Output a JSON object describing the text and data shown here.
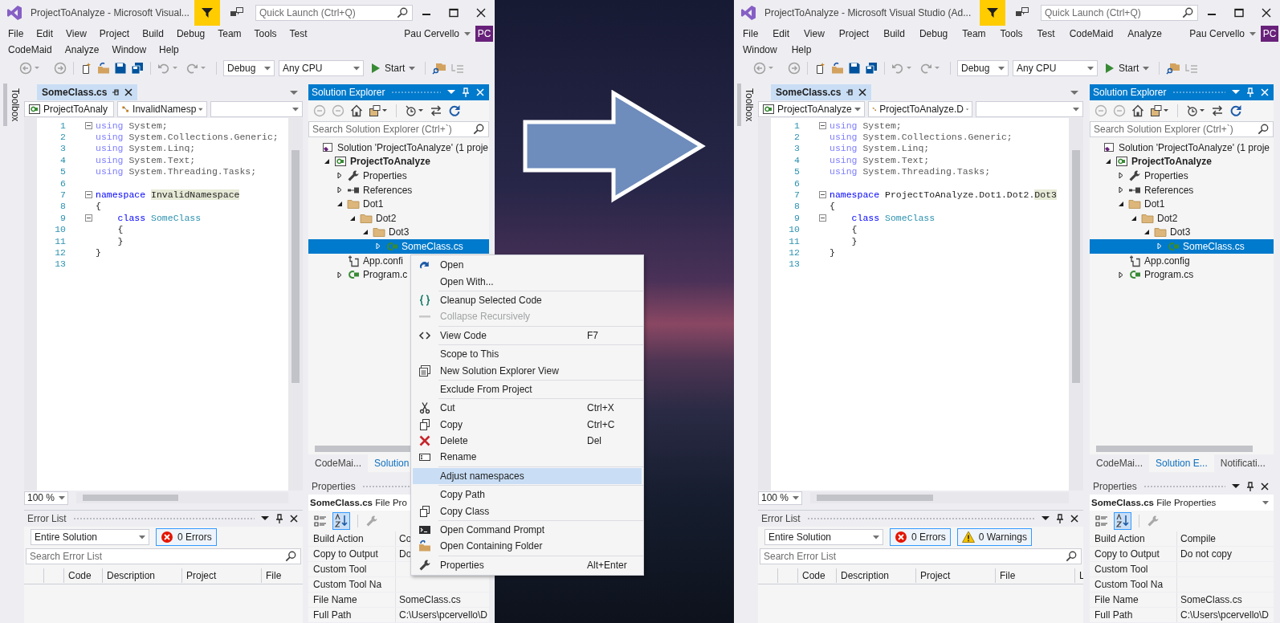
{
  "windows": [
    {
      "title": "ProjectToAnalyze - Microsoft Visual...",
      "quick_launch": {
        "placeholder": "Quick Launch (Ctrl+Q)"
      },
      "user": "Pau Cervello",
      "user_initials": "PC",
      "menu_rows": [
        [
          "File",
          "Edit",
          "View",
          "Project",
          "Build",
          "Debug",
          "Team",
          "Tools",
          "Test"
        ],
        [
          "CodeMaid",
          "Analyze",
          "Window",
          "Help"
        ]
      ],
      "toolbar": {
        "configuration": "Debug",
        "platform": "Any CPU",
        "start": "Start"
      },
      "toolbox": "Toolbox",
      "editor": {
        "tab": "SomeClass.cs",
        "project_nav": "ProjectToAnaly",
        "member_nav": "InvalidNamesp",
        "zoom": "100 %",
        "lines": [
          {
            "number": "1",
            "collapsible": true,
            "tokens": [
              {
                "kind": "unused_keyword",
                "text": "using"
              },
              {
                "kind": "unused",
                "text": " System;"
              }
            ]
          },
          {
            "number": "2",
            "collapsible": false,
            "tokens": [
              {
                "kind": "unused_keyword",
                "text": "using"
              },
              {
                "kind": "unused",
                "text": " System.Collections.Generic;"
              }
            ]
          },
          {
            "number": "3",
            "collapsible": false,
            "tokens": [
              {
                "kind": "unused_keyword",
                "text": "using"
              },
              {
                "kind": "unused",
                "text": " System.Linq;"
              }
            ]
          },
          {
            "number": "4",
            "collapsible": false,
            "tokens": [
              {
                "kind": "unused_keyword",
                "text": "using"
              },
              {
                "kind": "unused",
                "text": " System.Text;"
              }
            ]
          },
          {
            "number": "5",
            "collapsible": false,
            "tokens": [
              {
                "kind": "unused_keyword",
                "text": "using"
              },
              {
                "kind": "unused",
                "text": " System.Threading.Tasks;"
              }
            ]
          },
          {
            "number": "6",
            "collapsible": false
          },
          {
            "number": "7",
            "collapsible": true,
            "tokens": [
              {
                "kind": "keyword",
                "text": "namespace "
              },
              {
                "kind": "highlight",
                "text": "InvalidNamespace"
              }
            ]
          },
          {
            "number": "8",
            "collapsible": false,
            "tokens": [
              {
                "kind": "plain",
                "text": "{"
              }
            ]
          },
          {
            "number": "9",
            "collapsible": true,
            "tokens": [
              {
                "kind": "keyword",
                "text": "    class"
              },
              {
                "kind": "type",
                "text": " SomeClass"
              }
            ]
          },
          {
            "number": "10",
            "collapsible": false,
            "tokens": [
              {
                "kind": "plain",
                "text": "    {"
              }
            ]
          },
          {
            "number": "11",
            "collapsible": false,
            "tokens": [
              {
                "kind": "plain",
                "text": "    }"
              }
            ]
          },
          {
            "number": "12",
            "collapsible": false,
            "tokens": [
              {
                "kind": "plain",
                "text": "}"
              }
            ]
          },
          {
            "number": "13",
            "collapsible": false
          }
        ]
      },
      "error_list": {
        "title": "Error List",
        "scope": "Entire Solution",
        "filters": [
          {
            "kind": "errors",
            "label": "0 Errors",
            "selected": true
          }
        ],
        "search": {
          "placeholder": "Search Error List"
        },
        "columns": [
          "Code",
          "Description",
          "Project",
          "File"
        ]
      },
      "solution_explorer": {
        "title": "Solution Explorer",
        "search": {
          "placeholder": "Search Solution Explorer (Ctrl+`)"
        },
        "tree": [
          {
            "label": "Solution 'ProjectToAnalyze' (1 proje",
            "kind": "solution",
            "selected": false,
            "children": [
              {
                "label": "ProjectToAnalyze",
                "kind": "csproj",
                "expanded": true,
                "selected": false,
                "children": [
                  {
                    "label": "Properties",
                    "kind": "wrench",
                    "expanded": false,
                    "selected": false
                  },
                  {
                    "label": "References",
                    "kind": "references",
                    "expanded": false,
                    "selected": false
                  },
                  {
                    "label": "Dot1",
                    "kind": "folder",
                    "expanded": true,
                    "selected": false,
                    "children": [
                      {
                        "label": "Dot2",
                        "kind": "folder",
                        "expanded": true,
                        "selected": false,
                        "children": [
                          {
                            "label": "Dot3",
                            "kind": "folder",
                            "expanded": true,
                            "selected": false,
                            "children": [
                              {
                                "label": "SomeClass.cs",
                                "kind": "csfile",
                                "expanded": false,
                                "selected": true
                              }
                            ]
                          }
                        ]
                      }
                    ]
                  },
                  {
                    "label": "App.confi",
                    "kind": "config",
                    "selected": false
                  },
                  {
                    "label": "Program.c",
                    "kind": "csfile",
                    "expanded": false,
                    "selected": false
                  }
                ]
              }
            ]
          }
        ],
        "tabs": [
          {
            "label": "CodeMai...",
            "selected": false
          },
          {
            "label": "Solution",
            "selected": true
          }
        ]
      },
      "properties": {
        "title": "Properties",
        "object": "SomeClass.cs",
        "object_type": "File Pro",
        "rows": [
          {
            "name": "Build Action",
            "value": "Co"
          },
          {
            "name": "Copy to Output",
            "value": "Do"
          },
          {
            "name": "Custom Tool"
          },
          {
            "name": "Custom Tool Na"
          },
          {
            "name": "File Name",
            "value": "SomeClass.cs"
          },
          {
            "name": "Full Path",
            "value": "C:\\Users\\pcervello\\D"
          }
        ]
      }
    },
    {
      "title": "ProjectToAnalyze - Microsoft Visual Studio (Ad...",
      "quick_launch": {
        "placeholder": "Quick Launch (Ctrl+Q)"
      },
      "user": "Pau Cervello",
      "user_initials": "PC",
      "menu_rows": [
        [
          "File",
          "Edit",
          "View",
          "Project",
          "Build",
          "Debug",
          "Team",
          "Tools",
          "Test",
          "CodeMaid",
          "Analyze"
        ],
        [
          "Window",
          "Help"
        ]
      ],
      "toolbar": {
        "configuration": "Debug",
        "platform": "Any CPU",
        "start": "Start"
      },
      "toolbox": "Toolbox",
      "editor": {
        "tab": "SomeClass.cs",
        "project_nav": "ProjectToAnalyze",
        "member_nav": "ProjectToAnalyze.D",
        "zoom": "100 %",
        "lines": [
          {
            "number": "1",
            "collapsible": true,
            "tokens": [
              {
                "kind": "unused_keyword",
                "text": "using"
              },
              {
                "kind": "unused",
                "text": " System;"
              }
            ]
          },
          {
            "number": "2",
            "collapsible": false,
            "tokens": [
              {
                "kind": "unused_keyword",
                "text": "using"
              },
              {
                "kind": "unused",
                "text": " System.Collections.Generic;"
              }
            ]
          },
          {
            "number": "3",
            "collapsible": false,
            "tokens": [
              {
                "kind": "unused_keyword",
                "text": "using"
              },
              {
                "kind": "unused",
                "text": " System.Linq;"
              }
            ]
          },
          {
            "number": "4",
            "collapsible": false,
            "tokens": [
              {
                "kind": "unused_keyword",
                "text": "using"
              },
              {
                "kind": "unused",
                "text": " System.Text;"
              }
            ]
          },
          {
            "number": "5",
            "collapsible": false,
            "tokens": [
              {
                "kind": "unused_keyword",
                "text": "using"
              },
              {
                "kind": "unused",
                "text": " System.Threading.Tasks;"
              }
            ]
          },
          {
            "number": "6",
            "collapsible": false
          },
          {
            "number": "7",
            "collapsible": true,
            "tokens": [
              {
                "kind": "keyword",
                "text": "namespace"
              },
              {
                "kind": "plain",
                "text": " ProjectToAnalyze.Dot1.Dot2."
              },
              {
                "kind": "highlight",
                "text": "Dot3"
              }
            ]
          },
          {
            "number": "8",
            "collapsible": false,
            "tokens": [
              {
                "kind": "plain",
                "text": "{"
              }
            ]
          },
          {
            "number": "9",
            "collapsible": true,
            "tokens": [
              {
                "kind": "keyword",
                "text": "    class"
              },
              {
                "kind": "type",
                "text": " SomeClass"
              }
            ]
          },
          {
            "number": "10",
            "collapsible": false,
            "tokens": [
              {
                "kind": "plain",
                "text": "    {"
              }
            ]
          },
          {
            "number": "11",
            "collapsible": false,
            "tokens": [
              {
                "kind": "plain",
                "text": "    }"
              }
            ]
          },
          {
            "number": "12",
            "collapsible": false,
            "tokens": [
              {
                "kind": "plain",
                "text": "}"
              }
            ]
          },
          {
            "number": "13",
            "collapsible": false
          }
        ]
      },
      "error_list": {
        "title": "Error List",
        "scope": "Entire Solution",
        "filters": [
          {
            "kind": "errors",
            "label": "0 Errors",
            "selected": true
          },
          {
            "kind": "warnings",
            "label": "0 Warnings",
            "selected": true
          }
        ],
        "search": {
          "placeholder": "Search Error List"
        },
        "columns": [
          "Code",
          "Description",
          "Project",
          "File",
          "L"
        ]
      },
      "solution_explorer": {
        "title": "Solution Explorer",
        "search": {
          "placeholder": "Search Solution Explorer (Ctrl+`)"
        },
        "tree": [
          {
            "label": "Solution 'ProjectToAnalyze' (1 proje",
            "kind": "solution",
            "selected": false,
            "children": [
              {
                "label": "ProjectToAnalyze",
                "kind": "csproj",
                "expanded": true,
                "selected": false,
                "children": [
                  {
                    "label": "Properties",
                    "kind": "wrench",
                    "expanded": false,
                    "selected": false
                  },
                  {
                    "label": "References",
                    "kind": "references",
                    "expanded": false,
                    "selected": false
                  },
                  {
                    "label": "Dot1",
                    "kind": "folder",
                    "expanded": true,
                    "selected": false,
                    "children": [
                      {
                        "label": "Dot2",
                        "kind": "folder",
                        "expanded": true,
                        "selected": false,
                        "children": [
                          {
                            "label": "Dot3",
                            "kind": "folder",
                            "expanded": true,
                            "selected": false,
                            "children": [
                              {
                                "label": "SomeClass.cs",
                                "kind": "csfile",
                                "expanded": false,
                                "selected": true
                              }
                            ]
                          }
                        ]
                      }
                    ]
                  },
                  {
                    "label": "App.config",
                    "kind": "config",
                    "selected": false
                  },
                  {
                    "label": "Program.cs",
                    "kind": "csfile",
                    "expanded": false,
                    "selected": false
                  }
                ]
              }
            ]
          }
        ],
        "tabs": [
          {
            "label": "CodeMai...",
            "selected": false
          },
          {
            "label": "Solution E...",
            "selected": true
          },
          {
            "label": "Notificati...",
            "selected": false
          }
        ]
      },
      "properties": {
        "title": "Properties",
        "object": "SomeClass.cs",
        "object_type": "File Properties",
        "rows": [
          {
            "name": "Build Action",
            "value": "Compile"
          },
          {
            "name": "Copy to Output",
            "value": "Do not copy"
          },
          {
            "name": "Custom Tool"
          },
          {
            "name": "Custom Tool Na"
          },
          {
            "name": "File Name",
            "value": "SomeClass.cs"
          },
          {
            "name": "Full Path",
            "value": "C:\\Users\\pcervello\\D"
          }
        ]
      }
    }
  ],
  "context_menu": {
    "groups": [
      [
        {
          "label": "Open",
          "kind": "open",
          "disabled": false,
          "selected": false
        },
        {
          "label": "Open With...",
          "disabled": false,
          "selected": false
        }
      ],
      [
        {
          "label": "Cleanup Selected Code",
          "kind": "braces",
          "disabled": false,
          "selected": false
        },
        {
          "label": "Collapse Recursively",
          "kind": "dash",
          "disabled": true,
          "selected": false
        }
      ],
      [
        {
          "label": "View Code",
          "kind": "angle-brackets",
          "shortcut": "F7",
          "disabled": false,
          "selected": false
        }
      ],
      [
        {
          "label": "Scope to This",
          "disabled": false,
          "selected": false
        },
        {
          "label": "New Solution Explorer View",
          "kind": "window-list",
          "disabled": false,
          "selected": false
        }
      ],
      [
        {
          "label": "Exclude From Project",
          "disabled": false,
          "selected": false
        }
      ],
      [
        {
          "label": "Cut",
          "kind": "scissors",
          "shortcut": "Ctrl+X",
          "disabled": false,
          "selected": false
        },
        {
          "label": "Copy",
          "kind": "copy",
          "shortcut": "Ctrl+C",
          "disabled": false,
          "selected": false
        },
        {
          "label": "Delete",
          "kind": "cross",
          "shortcut": "Del",
          "disabled": false,
          "selected": false
        },
        {
          "label": "Rename",
          "kind": "rename",
          "disabled": false,
          "selected": false
        }
      ],
      [
        {
          "label": "Adjust namespaces",
          "disabled": false,
          "selected": true
        }
      ],
      [
        {
          "label": "Copy Path",
          "disabled": false,
          "selected": false
        },
        {
          "label": "Copy Class",
          "kind": "copy",
          "disabled": false,
          "selected": false
        }
      ],
      [
        {
          "label": "Open Command Prompt",
          "kind": "console",
          "disabled": false,
          "selected": false
        },
        {
          "label": "Open Containing Folder",
          "kind": "folder-open",
          "disabled": false,
          "selected": false
        }
      ],
      [
        {
          "label": "Properties",
          "kind": "wrench",
          "shortcut": "Alt+Enter",
          "disabled": false,
          "selected": false
        }
      ]
    ]
  }
}
